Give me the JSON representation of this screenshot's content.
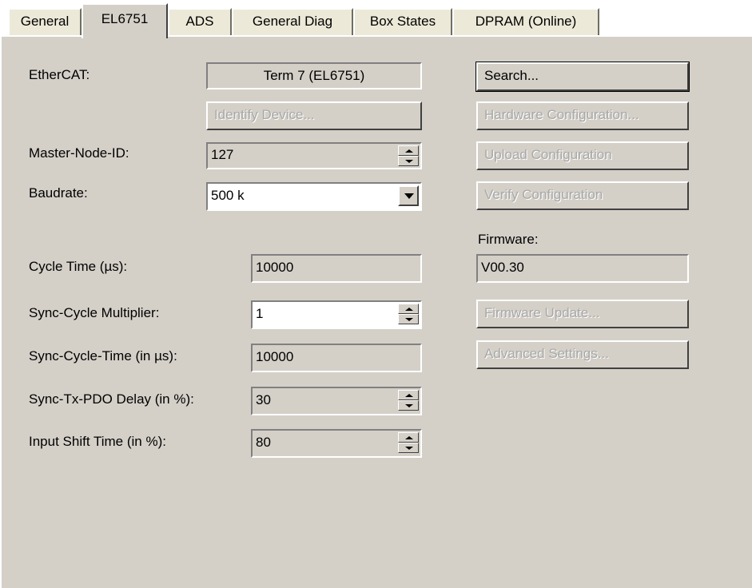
{
  "tabs": [
    {
      "label": "General"
    },
    {
      "label": "EL6751",
      "active": true
    },
    {
      "label": "ADS"
    },
    {
      "label": "General Diag"
    },
    {
      "label": "Box States"
    },
    {
      "label": "DPRAM (Online)"
    }
  ],
  "form": {
    "ethercat_label": "EtherCAT:",
    "ethercat_value": "Term 7 (EL6751)",
    "identify_button": "Identify Device...",
    "master_node_label": "Master-Node-ID:",
    "master_node_value": "127",
    "baudrate_label": "Baudrate:",
    "baudrate_value": "500 k",
    "cycle_time_label": "Cycle Time (µs):",
    "cycle_time_value": "10000",
    "sync_mult_label": "Sync-Cycle Multiplier:",
    "sync_mult_value": "1",
    "sync_cycle_time_label": "Sync-Cycle-Time (in µs):",
    "sync_cycle_time_value": "10000",
    "sync_tx_label": "Sync-Tx-PDO Delay (in %):",
    "sync_tx_value": "30",
    "input_shift_label": "Input Shift Time (in %):",
    "input_shift_value": "80"
  },
  "right": {
    "search_button": "Search...",
    "hardware_button": "Hardware Configuration...",
    "upload_button": "Upload Configuration",
    "verify_button": "Verify Configuration",
    "firmware_label": "Firmware:",
    "firmware_value": "V00.30",
    "firmware_update_button": "Firmware Update...",
    "advanced_button": "Advanced Settings..."
  }
}
